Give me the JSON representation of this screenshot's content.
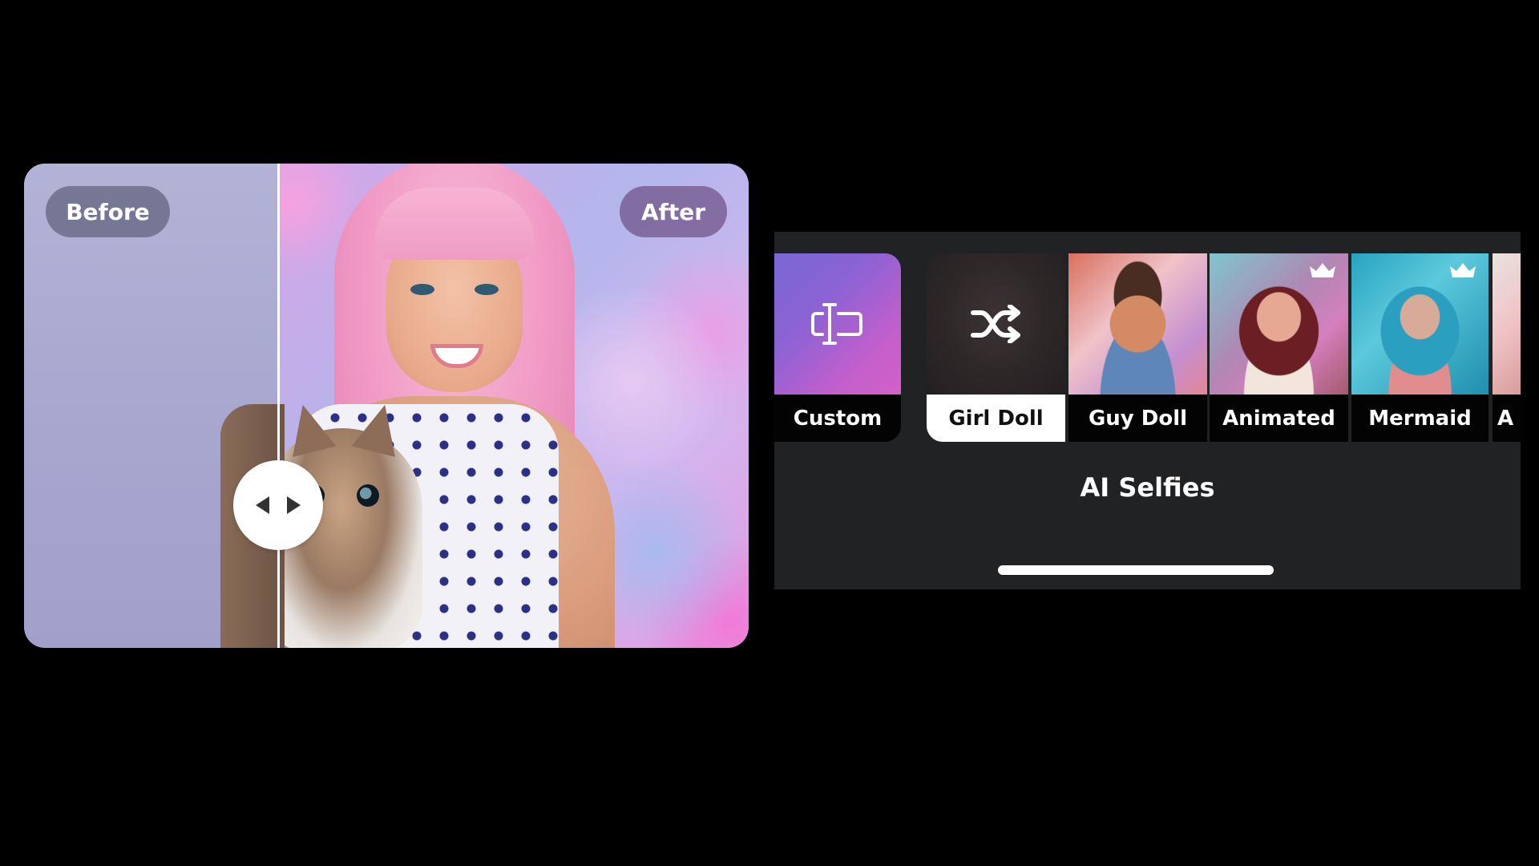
{
  "compare": {
    "before_label": "Before",
    "after_label": "After",
    "slider_position_percent": 35
  },
  "effects_panel": {
    "items": [
      {
        "label": "Custom",
        "icon": "text-cursor-box-icon",
        "selected": false,
        "premium": false
      },
      {
        "label": "Girl Doll",
        "icon": "shuffle-icon",
        "selected": true,
        "premium": false
      },
      {
        "label": "Guy Doll",
        "selected": false,
        "premium": false
      },
      {
        "label": "Animated",
        "selected": false,
        "premium": true
      },
      {
        "label": "Mermaid",
        "selected": false,
        "premium": true
      },
      {
        "label": "A",
        "selected": false,
        "premium": false
      }
    ],
    "section_title": "AI Selfies"
  },
  "colors": {
    "panel_background": "#212224",
    "custom_gradient_start": "#7a68d6",
    "custom_gradient_end": "#d461c8",
    "selected_label_background": "#ffffff"
  }
}
